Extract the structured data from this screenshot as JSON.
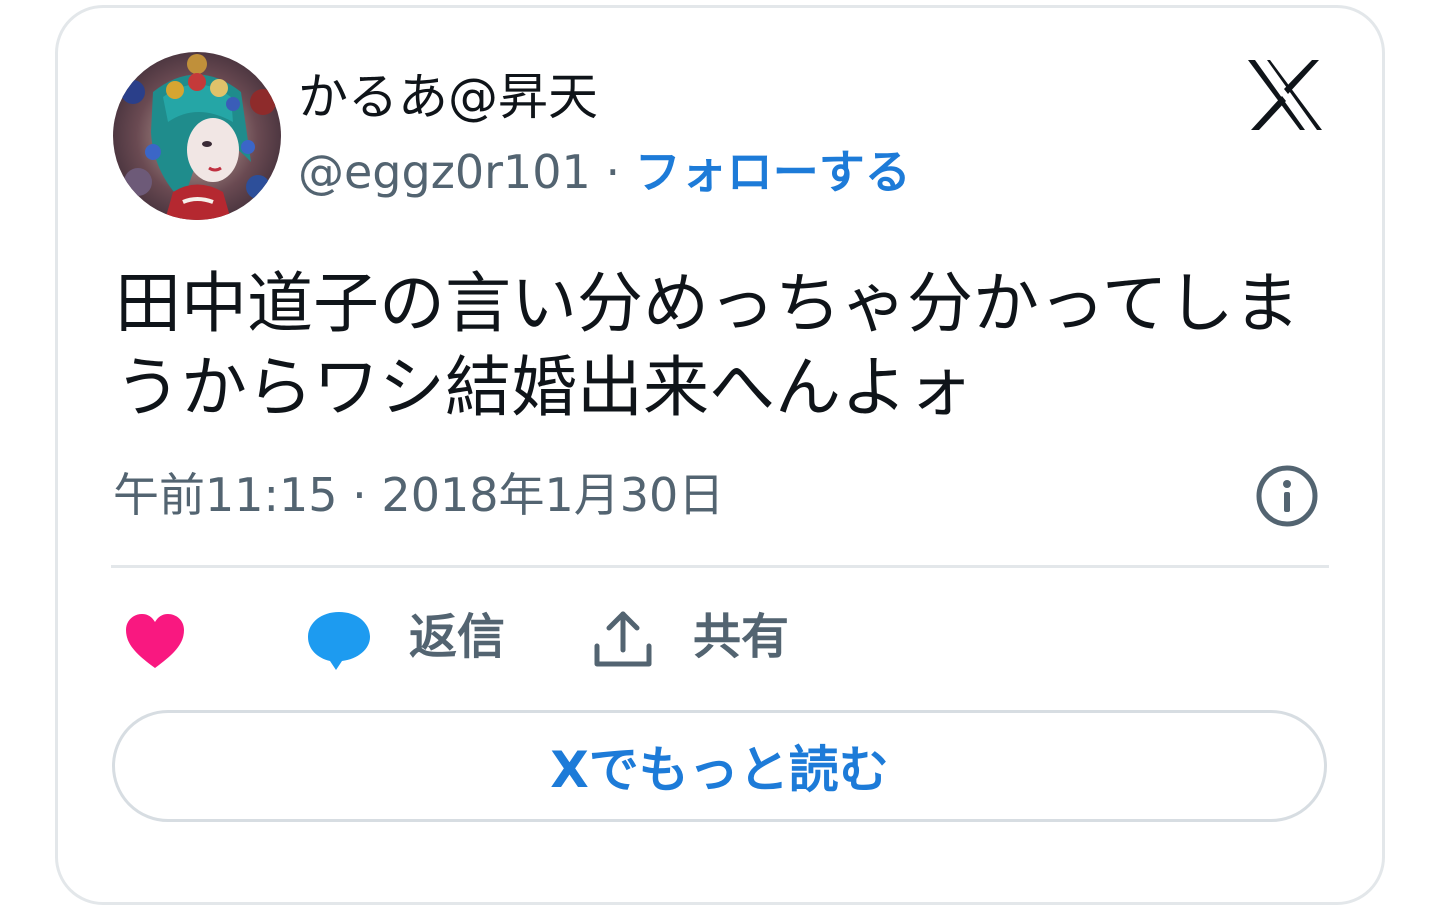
{
  "user": {
    "display_name": "かるあ@昇天",
    "handle": "@eggz0r101",
    "separator": "·",
    "follow_label": "フォローする"
  },
  "brand": {
    "logo": "x-logo-icon"
  },
  "tweet": {
    "text": "田中道子の言い分めっちゃ分かってしまうからワシ結婚出来へんよォ",
    "timestamp": "午前11:15 · 2018年1月30日"
  },
  "actions": {
    "like_icon": "heart-icon",
    "reply_icon": "speech-bubble-icon",
    "reply_label": "返信",
    "share_icon": "upload-icon",
    "share_label": "共有",
    "info_icon": "info-icon"
  },
  "footer": {
    "read_more_label": "Xでもっと読む"
  },
  "colors": {
    "accent": "#1d7bd8",
    "heart": "#f91880",
    "reply_bubble": "#1d9bf0",
    "text_primary": "#0f1419",
    "text_secondary": "#536471",
    "border": "#e3e7ea"
  }
}
